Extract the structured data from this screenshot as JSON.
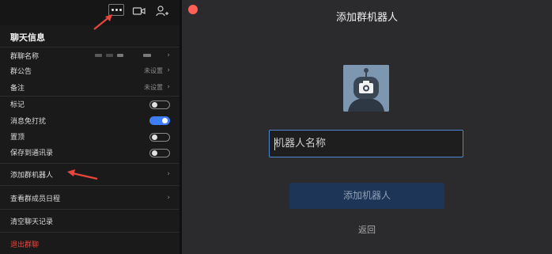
{
  "left_panel": {
    "title": "聊天信息",
    "rows": [
      {
        "label": "群聊名称",
        "value": "",
        "chevron": "›"
      },
      {
        "label": "群公告",
        "value": "未设置",
        "chevron": "›"
      },
      {
        "label": "备注",
        "value": "未设置",
        "chevron": "›"
      },
      {
        "label": "标记",
        "toggle": false
      },
      {
        "label": "消息免打扰",
        "toggle": true
      },
      {
        "label": "置顶",
        "toggle": false
      },
      {
        "label": "保存到通讯录",
        "toggle": false
      }
    ],
    "add_robot": {
      "label": "添加群机器人",
      "chevron": "›"
    },
    "view_schedule": {
      "label": "查看群成员日程",
      "chevron": "›"
    },
    "clear_history": {
      "label": "清空聊天记录"
    },
    "exit_group": {
      "label": "退出群聊"
    },
    "colors": {
      "danger": "#e8453c",
      "toggle_on": "#3d7df5",
      "arrow": "#e8453c"
    },
    "top_icons": [
      "more-icon",
      "video-icon",
      "add-member-icon"
    ]
  },
  "dialog": {
    "title": "添加群机器人",
    "input_placeholder": "机器人名称",
    "submit_label": "添加机器人",
    "back_label": "返回",
    "colors": {
      "close": "#ff5f57",
      "input_border": "#4f86d6",
      "button_bg": "#1d3557",
      "avatar_bg": "#7e97b1"
    }
  }
}
